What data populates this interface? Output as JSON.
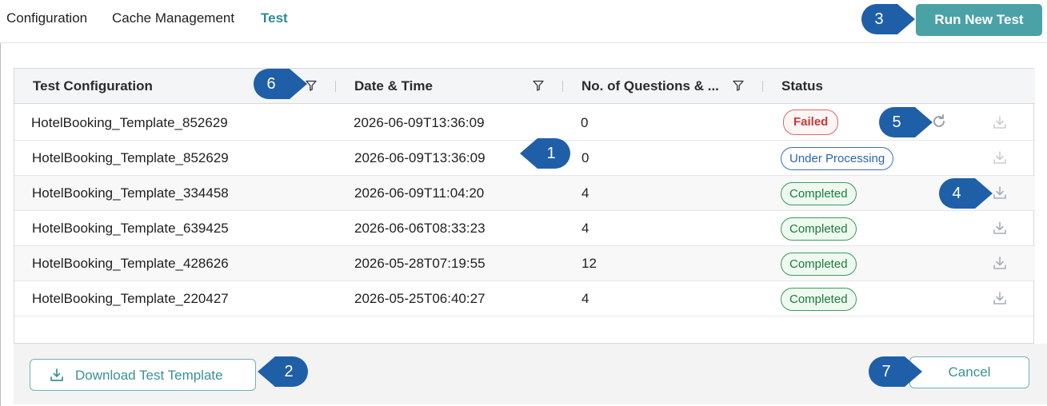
{
  "nav": {
    "tabs": [
      {
        "label": "Configuration"
      },
      {
        "label": "Cache Management"
      },
      {
        "label": "Test"
      }
    ],
    "run_new_test_label": "Run New Test"
  },
  "table": {
    "columns": [
      {
        "label": "Test Configuration"
      },
      {
        "label": "Date & Time"
      },
      {
        "label": "No. of Questions & ..."
      },
      {
        "label": "Status"
      }
    ],
    "rows": [
      {
        "config": "HotelBooking_Template_852629",
        "datetime": "2026-06-09T13:36:09",
        "questions": "0",
        "status": "Failed"
      },
      {
        "config": "HotelBooking_Template_852629",
        "datetime": "2026-06-09T13:36:09",
        "questions": "0",
        "status": "Under Processing"
      },
      {
        "config": "HotelBooking_Template_334458",
        "datetime": "2026-06-09T11:04:20",
        "questions": "4",
        "status": "Completed"
      },
      {
        "config": "HotelBooking_Template_639425",
        "datetime": "2026-06-06T08:33:23",
        "questions": "4",
        "status": "Completed"
      },
      {
        "config": "HotelBooking_Template_428626",
        "datetime": "2026-05-28T07:19:55",
        "questions": "12",
        "status": "Completed"
      },
      {
        "config": "HotelBooking_Template_220427",
        "datetime": "2026-05-25T06:40:27",
        "questions": "4",
        "status": "Completed"
      }
    ]
  },
  "footer": {
    "download_template_label": "Download Test Template",
    "cancel_label": "Cancel"
  },
  "callouts": [
    "1",
    "2",
    "3",
    "4",
    "5",
    "6",
    "7"
  ],
  "colors": {
    "accent": "#4aa2a6",
    "callout": "#1f5fa8",
    "failed": "#c83838",
    "processing": "#2d64b0",
    "completed": "#1f7a3d"
  },
  "icons": [
    "filter-icon",
    "refresh-icon",
    "download-icon"
  ]
}
